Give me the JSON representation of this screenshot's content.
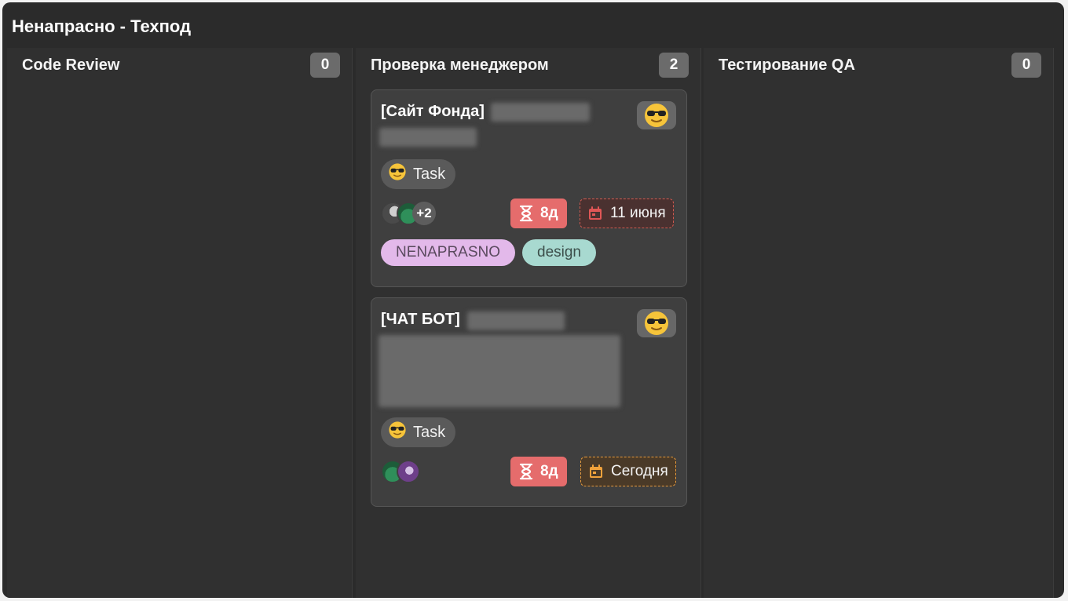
{
  "board": {
    "title": "Ненапрасно - Техпод"
  },
  "columns": [
    {
      "title": "Code Review",
      "count": "0"
    },
    {
      "title": "Проверка менеджером",
      "count": "2"
    },
    {
      "title": "Тестирование QA",
      "count": "0"
    }
  ],
  "cards": [
    {
      "title_prefix": "[Сайт Фонда]",
      "title_hidden": true,
      "type_label": "Task",
      "extra_assignees": "+2",
      "duration": "8д",
      "due_date": "11 июня",
      "due_status_color": "#d05a50",
      "tags": [
        "NENAPRASNO",
        "design"
      ]
    },
    {
      "title_prefix": "[ЧАТ БОТ]",
      "title_hidden": true,
      "type_label": "Task",
      "duration": "8д",
      "due_date": "Сегодня",
      "due_status_color": "#e79a3c"
    }
  ],
  "colors": {
    "board_bg": "#2b2b2b",
    "card_bg": "#3f3f3f",
    "duration_badge": "#e56c6c",
    "tag_nenaprasno": "#e3b9ea",
    "tag_design": "#a8d9d0"
  },
  "icons": {
    "card_type": "sunglasses-emoji-icon",
    "duration": "hourglass-icon",
    "due_date": "calendar-icon"
  }
}
